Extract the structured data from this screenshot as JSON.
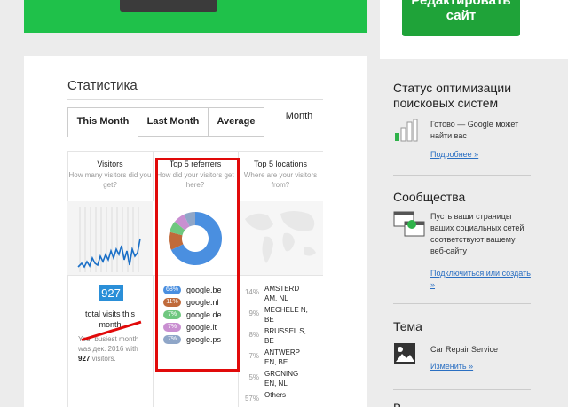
{
  "banner": {
    "color": "#1fc14a"
  },
  "edit_button": {
    "line1": "Редактировать",
    "line2": "сайт"
  },
  "stats": {
    "title": "Статистика",
    "tabs": [
      {
        "label": "This Month",
        "active": true
      },
      {
        "label": "Last Month",
        "active": false
      },
      {
        "label": "Average",
        "active": false
      },
      {
        "label": "Month",
        "active": false
      }
    ],
    "columns": {
      "visitors": {
        "heading": "Visitors",
        "sub": "How many visitors did you get?"
      },
      "referrers": {
        "heading": "Top 5 referrers",
        "sub": "How did your visitors get here?"
      },
      "locations": {
        "heading": "Top 5 locations",
        "sub": "Where are your visitors from?"
      }
    },
    "visits_total": "927",
    "visits_label": "total visits this month",
    "visits_note_pre": "Your busiest month was дек. 2016 with",
    "visits_note_count": "927",
    "visits_note_post": "visitors.",
    "referrers": [
      {
        "pct": "68%",
        "name": "google.be",
        "color": "#4a8fe0"
      },
      {
        "pct": "11%",
        "name": "google.nl",
        "color": "#c06a3a"
      },
      {
        "pct": "7%",
        "name": "google.de",
        "color": "#6fc77f"
      },
      {
        "pct": "7%",
        "name": "google.it",
        "color": "#c98fd1"
      },
      {
        "pct": "7%",
        "name": "google.ps",
        "color": "#8fa6c8"
      }
    ],
    "locations": [
      {
        "pct": "14%",
        "name": "AMSTERD AM, NL"
      },
      {
        "pct": "9%",
        "name": "MECHELE N, BE"
      },
      {
        "pct": "8%",
        "name": "BRUSSEL S, BE"
      },
      {
        "pct": "7%",
        "name": "ANTWERP EN, BE"
      },
      {
        "pct": "5%",
        "name": "GRONING EN, NL"
      },
      {
        "pct": "57%",
        "name": "Others"
      }
    ]
  },
  "chart_data": {
    "type": "pie",
    "title": "",
    "categories": [
      "google.be",
      "google.nl",
      "google.de",
      "google.it",
      "google.ps"
    ],
    "values": [
      68,
      11,
      7,
      7,
      7
    ],
    "colors": [
      "#4a8fe0",
      "#c06a3a",
      "#6fc77f",
      "#c98fd1",
      "#8fa6c8"
    ]
  },
  "sidebar": {
    "seo": {
      "title": "Статус оптимизации поисковых систем",
      "text": "Готово — Google может найти вас",
      "link": "Подробнее »"
    },
    "social": {
      "title": "Сообщества",
      "text": "Пусть ваши страницы ваших социальных сетей соответствуют вашему веб-сайту",
      "link": "Подключиться или создать »"
    },
    "theme": {
      "title": "Тема",
      "text": "Car Repair Service",
      "link": "Изменить »"
    },
    "next": {
      "title": "В"
    }
  }
}
